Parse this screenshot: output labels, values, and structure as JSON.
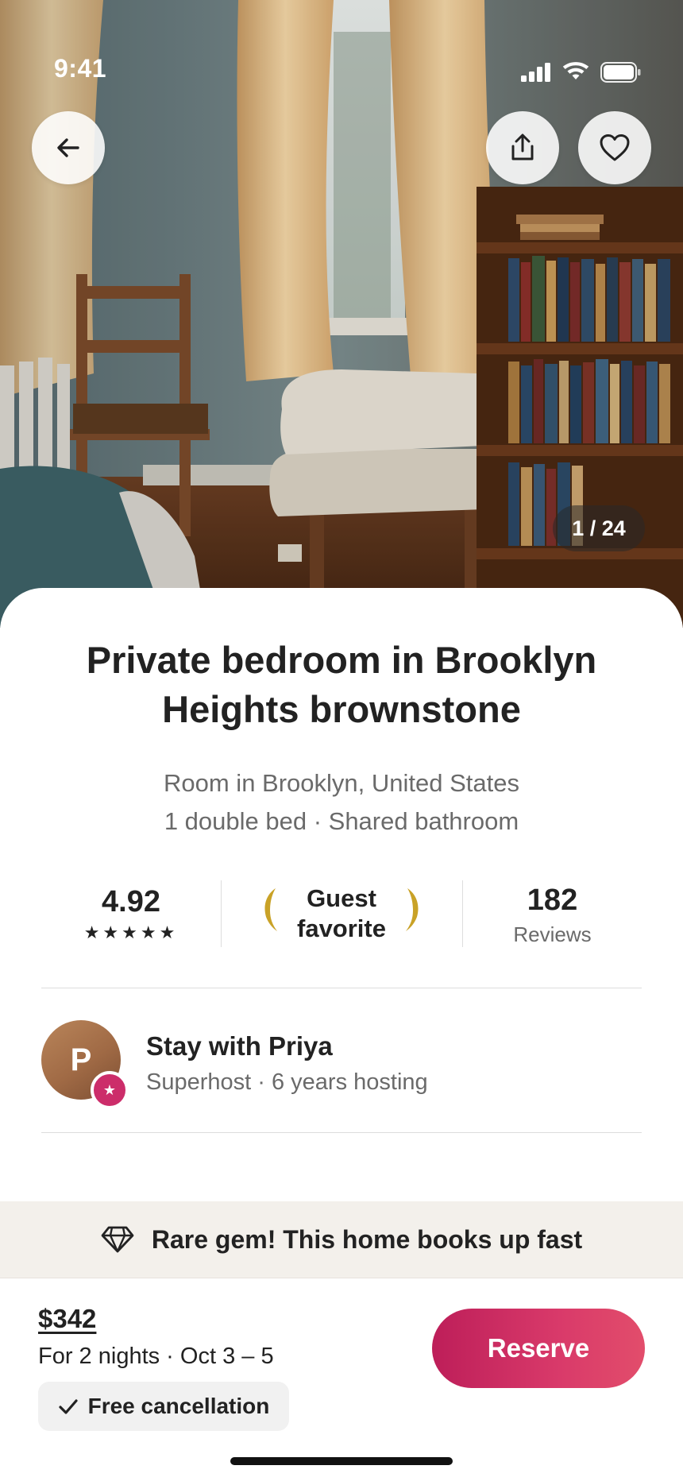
{
  "status_bar": {
    "time": "9:41"
  },
  "photo": {
    "counter": "1 / 24"
  },
  "listing": {
    "title": "Private bedroom in Brooklyn Heights brownstone",
    "subtitle_line1": "Room in Brooklyn, United States",
    "subtitle_line2": "1 double bed · Shared bathroom"
  },
  "stats": {
    "rating": "4.92",
    "stars": "★★★★★",
    "badge_line1": "Guest",
    "badge_line2": "favorite",
    "reviews_count": "182",
    "reviews_label": "Reviews"
  },
  "host": {
    "initial": "P",
    "title": "Stay with Priya",
    "subtitle": "Superhost · 6 years hosting",
    "badge_icon": "star-icon"
  },
  "banner": {
    "text": "Rare gem! This home books up fast",
    "icon": "diamond-icon"
  },
  "footer": {
    "price": "$342",
    "price_detail": "For 2 nights · Oct 3 – 5",
    "cancellation": "Free cancellation",
    "reserve_label": "Reserve"
  },
  "colors": {
    "accent": "#d43b6a",
    "accent_dark": "#bd1e59",
    "banner_bg": "#f3f0eb",
    "laurel": "#c9a227"
  },
  "icons": [
    "back-arrow-icon",
    "share-icon",
    "heart-icon",
    "wifi-icon",
    "signal-icon",
    "battery-icon",
    "checkmark-icon"
  ]
}
